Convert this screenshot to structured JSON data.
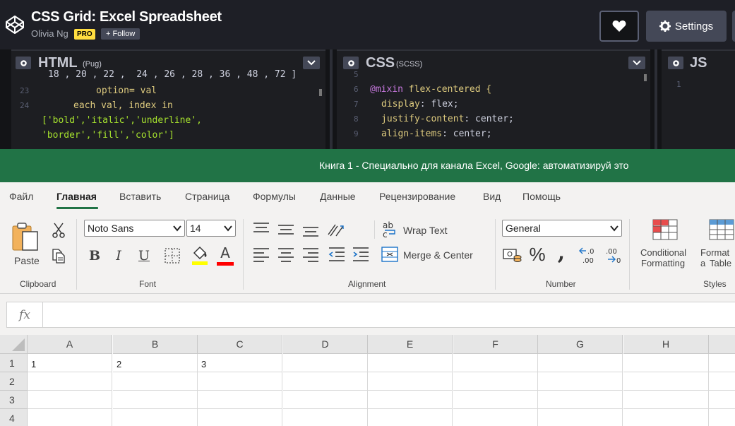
{
  "codepen": {
    "title": "CSS Grid: Excel Spreadsheet",
    "author": "Olivia Ng",
    "pro_badge": "PRO",
    "follow_label": "+ Follow",
    "settings_label": "Settings"
  },
  "editors": {
    "html": {
      "title": "HTML",
      "sub": "(Pug)"
    },
    "css": {
      "title": "CSS",
      "sub": "(SCSS)"
    },
    "js": {
      "title": "JS",
      "line1": "1"
    }
  },
  "html_code": {
    "top": "18 , 20 , 22 ,  24 , 26 , 28 , 36 , 48 , 72 ]",
    "ln23": "23",
    "l23": "option= val",
    "ln24": "24",
    "l24": "each val, index in",
    "l25": "['bold','italic','underline',",
    "l26": "'border','fill','color']"
  },
  "css_code": {
    "ln5": "5",
    "ln6": "6",
    "l6_at": "@mixin",
    "l6_name": " flex-centered {",
    "ln7": "7",
    "l7_prop": "display",
    "l7_val": ": flex;",
    "ln8": "8",
    "l8_prop": "justify-content",
    "l8_val": ": center;",
    "ln9": "9",
    "l9_prop": "align-items",
    "l9_val": ": center;"
  },
  "excel": {
    "title": "Книга 1 - Специально для канала Excel, Google: автоматизируй это",
    "menu": [
      "Файл",
      "Главная",
      "Вставить",
      "Страница",
      "Формулы",
      "Данные",
      "Рецензирование",
      "Вид",
      "Помощь"
    ],
    "active_menu_color": "#217346",
    "ribbon": {
      "paste": "Paste",
      "clipboard": "Clipboard",
      "font_name": "Noto Sans",
      "font_size": "14",
      "font": "Font",
      "bold": "B",
      "italic": "I",
      "underline": "U",
      "font_color_letter": "A",
      "wrap_text": "Wrap Text",
      "merge_center": "Merge & Center",
      "alignment": "Alignment",
      "number_format": "General",
      "percent": "%",
      "comma": ",",
      "number": "Number",
      "conditional": "Conditional",
      "formatting": "Formatting",
      "format_as": "Format a",
      "table": "Table",
      "styles": "Styles",
      "fill_color": "#ffff00",
      "font_color": "#ff0000"
    },
    "formula": {
      "fx": "fx",
      "value": ""
    },
    "columns": [
      "A",
      "B",
      "C",
      "D",
      "E",
      "F",
      "G",
      "H"
    ],
    "rows": [
      {
        "num": "1",
        "cells": [
          "1",
          "2",
          "3",
          "",
          "",
          "",
          "",
          ""
        ]
      },
      {
        "num": "2",
        "cells": [
          "",
          "",
          "",
          "",
          "",
          "",
          "",
          ""
        ]
      },
      {
        "num": "3",
        "cells": [
          "",
          "",
          "",
          "",
          "",
          "",
          "",
          ""
        ]
      },
      {
        "num": "4",
        "cells": [
          "",
          "",
          "",
          "",
          "",
          "",
          "",
          ""
        ]
      }
    ]
  }
}
